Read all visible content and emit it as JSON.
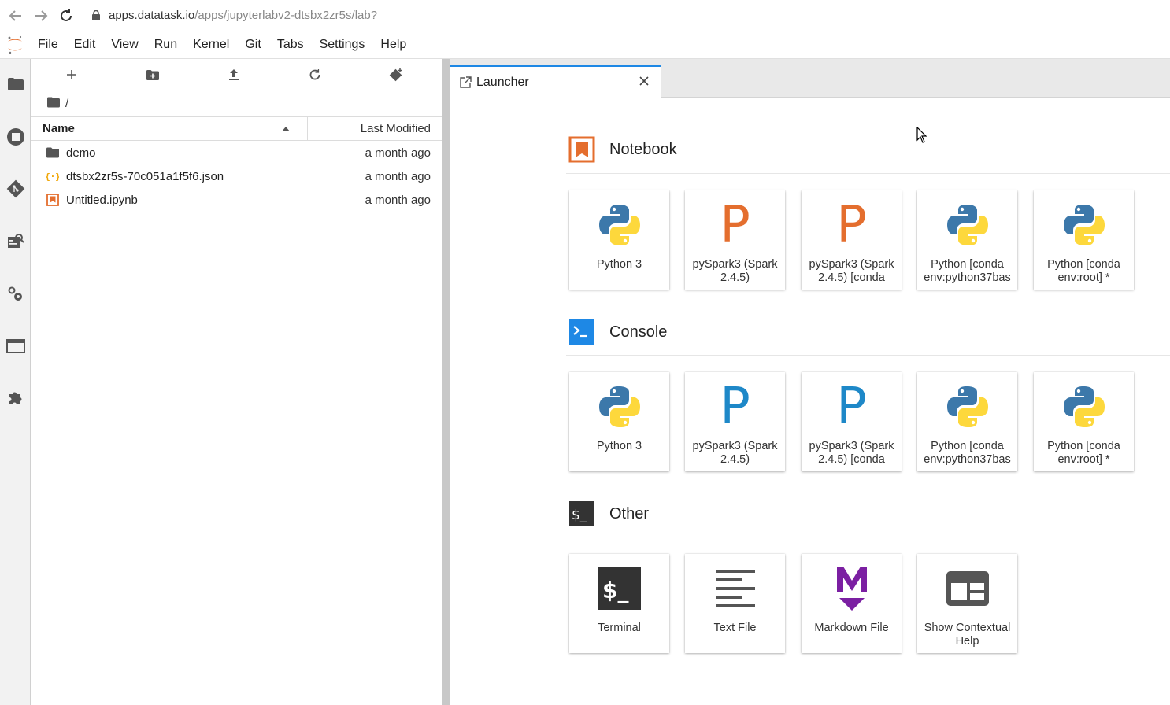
{
  "browser": {
    "url_host": "apps.datatask.io",
    "url_path": "/apps/jupyterlabv2-dtsbx2zr5s/lab?"
  },
  "menu": [
    "File",
    "Edit",
    "View",
    "Run",
    "Kernel",
    "Git",
    "Tabs",
    "Settings",
    "Help"
  ],
  "sidebar_icons": [
    "folder-icon",
    "running-icon",
    "git-icon",
    "property-inspector-icon",
    "extensions-settings-icon",
    "tabs-icon",
    "extension-manager-icon"
  ],
  "filebrowser": {
    "breadcrumb": "/",
    "col_name": "Name",
    "col_modified": "Last Modified",
    "files": [
      {
        "name": "demo",
        "modified": "a month ago",
        "type": "folder"
      },
      {
        "name": "dtsbx2zr5s-70c051a1f5f6.json",
        "modified": "a month ago",
        "type": "json"
      },
      {
        "name": "Untitled.ipynb",
        "modified": "a month ago",
        "type": "notebook"
      }
    ]
  },
  "tab": {
    "label": "Launcher"
  },
  "launcher": {
    "sections": [
      {
        "title": "Notebook",
        "icon": "notebook-section-icon",
        "cards": [
          {
            "label": "Python 3",
            "icon": "python"
          },
          {
            "label": "pySpark3 (Spark 2.4.5)",
            "icon": "P-orange"
          },
          {
            "label": "pySpark3 (Spark 2.4.5) [conda",
            "icon": "P-orange"
          },
          {
            "label": "Python [conda env:python37bas",
            "icon": "python"
          },
          {
            "label": "Python [conda env:root] *",
            "icon": "python"
          }
        ]
      },
      {
        "title": "Console",
        "icon": "console-section-icon",
        "cards": [
          {
            "label": "Python 3",
            "icon": "python"
          },
          {
            "label": "pySpark3 (Spark 2.4.5)",
            "icon": "P-blue"
          },
          {
            "label": "pySpark3 (Spark 2.4.5) [conda",
            "icon": "P-blue"
          },
          {
            "label": "Python [conda env:python37bas",
            "icon": "python"
          },
          {
            "label": "Python [conda env:root] *",
            "icon": "python"
          }
        ]
      },
      {
        "title": "Other",
        "icon": "other-section-icon",
        "cards": [
          {
            "label": "Terminal",
            "icon": "terminal"
          },
          {
            "label": "Text File",
            "icon": "textfile"
          },
          {
            "label": "Markdown File",
            "icon": "markdown"
          },
          {
            "label": "Show Contextual Help",
            "icon": "help"
          }
        ]
      }
    ]
  },
  "colors": {
    "accent_blue": "#1e88e5",
    "jupyter_orange": "#e46e2e",
    "pyspark_orange": "#e46e2e",
    "pyspark_blue": "#1e88c8",
    "markdown_purple": "#7b1fa2"
  }
}
